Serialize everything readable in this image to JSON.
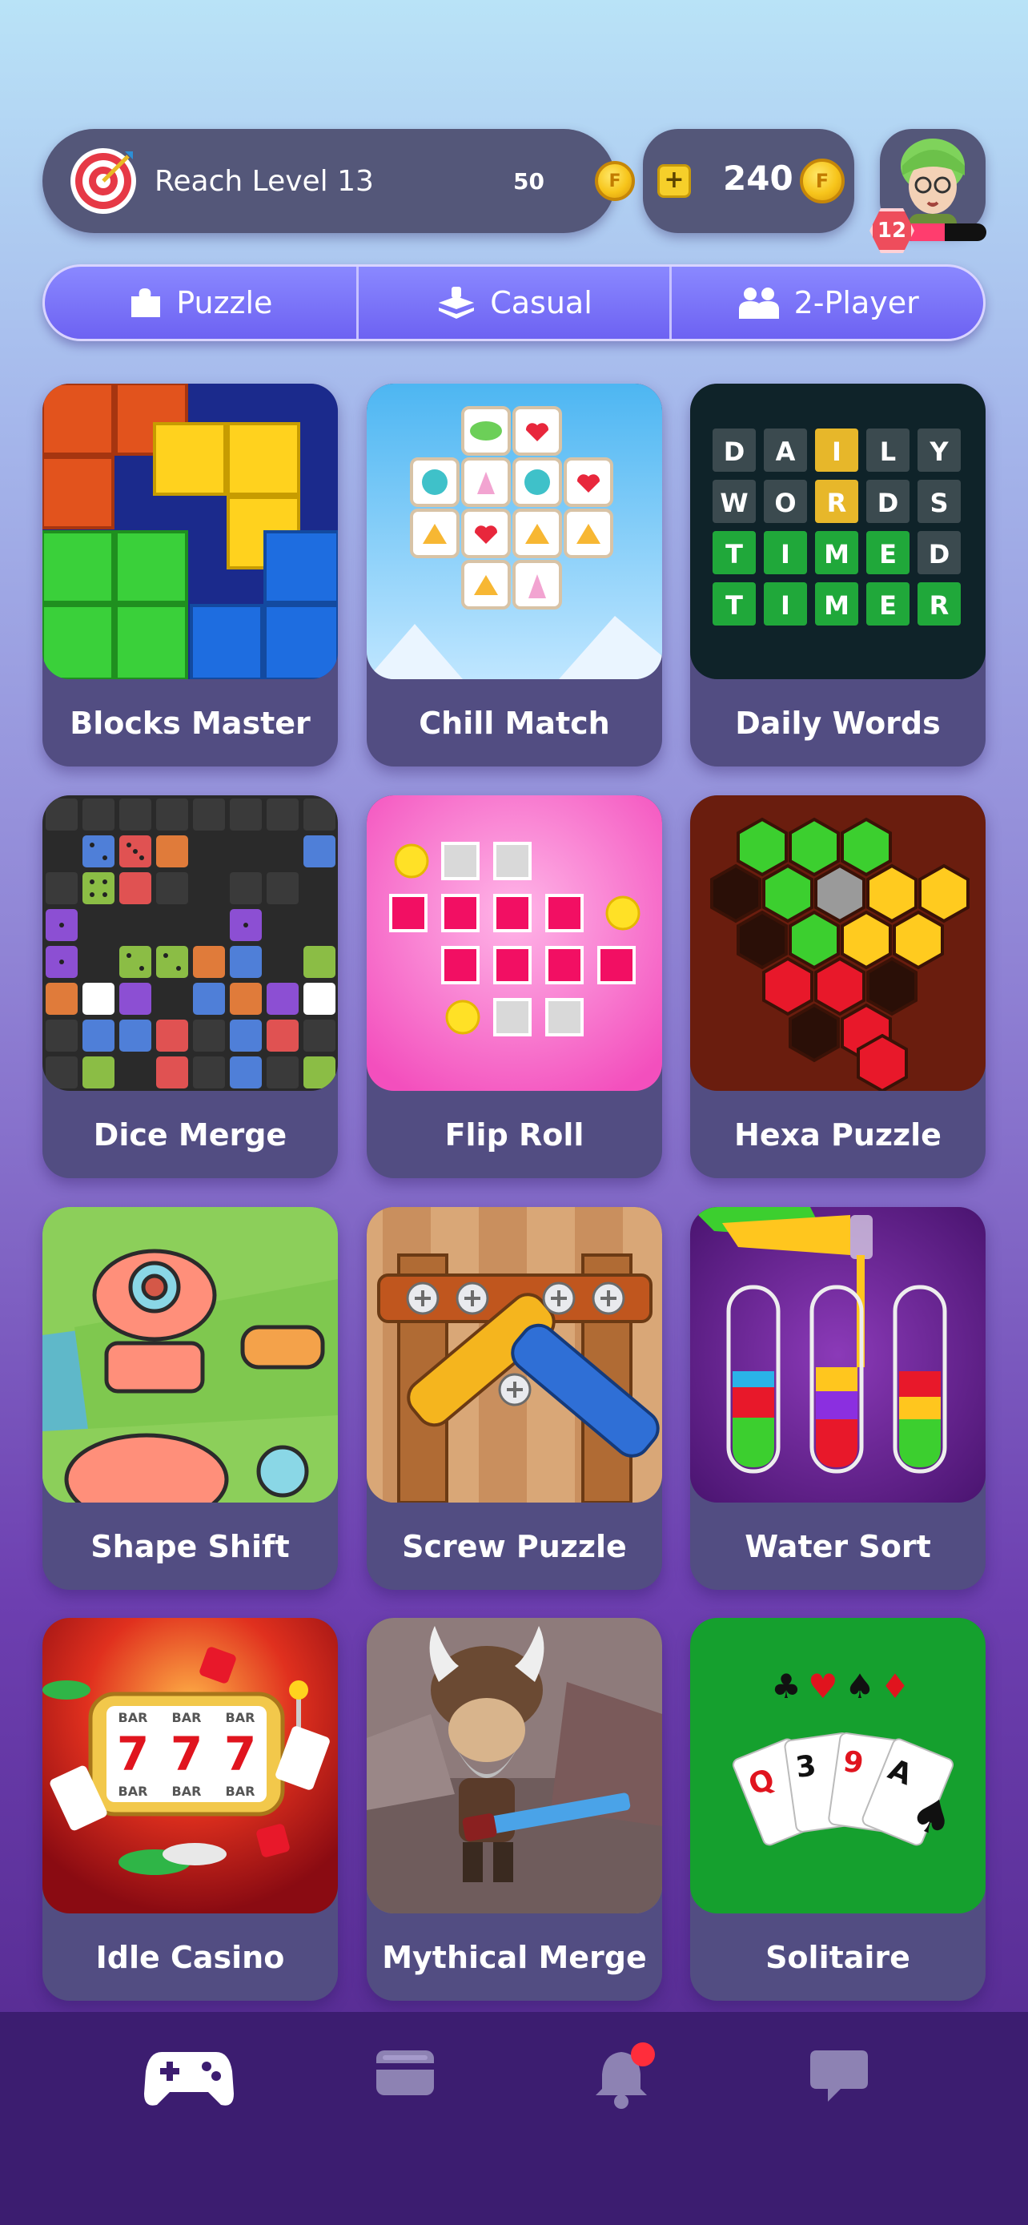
{
  "header": {
    "goal_text": "Reach Level 13",
    "goal_reward": "50",
    "coin_symbol": "F",
    "balance": "240",
    "plus_symbol": "+",
    "level": "12",
    "level_progress": 0.5
  },
  "tabs": [
    {
      "label": "Puzzle",
      "icon": "puzzle-icon"
    },
    {
      "label": "Casual",
      "icon": "casual-icon"
    },
    {
      "label": "2-Player",
      "icon": "two-player-icon"
    }
  ],
  "games": [
    {
      "name": "Blocks Master"
    },
    {
      "name": "Chill Match"
    },
    {
      "name": "Daily Words",
      "letters": [
        [
          "D",
          "A",
          "I",
          "L",
          "Y"
        ],
        [
          "W",
          "O",
          "R",
          "D",
          "S"
        ],
        [
          "T",
          "I",
          "M",
          "E",
          "D"
        ],
        [
          "T",
          "I",
          "M",
          "E",
          "R"
        ]
      ]
    },
    {
      "name": "Dice Merge"
    },
    {
      "name": "Flip Roll"
    },
    {
      "name": "Hexa Puzzle"
    },
    {
      "name": "Shape Shift"
    },
    {
      "name": "Screw Puzzle"
    },
    {
      "name": "Water Sort"
    },
    {
      "name": "Idle Casino",
      "reel": [
        "7",
        "7",
        "7"
      ],
      "bar": "BAR"
    },
    {
      "name": "Mythical Merge"
    },
    {
      "name": "Solitaire",
      "cards": [
        "Q",
        "3",
        "9",
        "A"
      ]
    }
  ],
  "nav": [
    {
      "icon": "gamepad-icon",
      "active": true
    },
    {
      "icon": "wallet-icon",
      "active": false
    },
    {
      "icon": "bell-icon",
      "active": false,
      "badge": true
    },
    {
      "icon": "chat-icon",
      "active": false
    }
  ],
  "colors": {
    "tab_gradient_top": "#8a88ff",
    "card_bg": "#524d82",
    "nav_bg": "#3c1d70",
    "badge_red": "#ff2d3b"
  }
}
